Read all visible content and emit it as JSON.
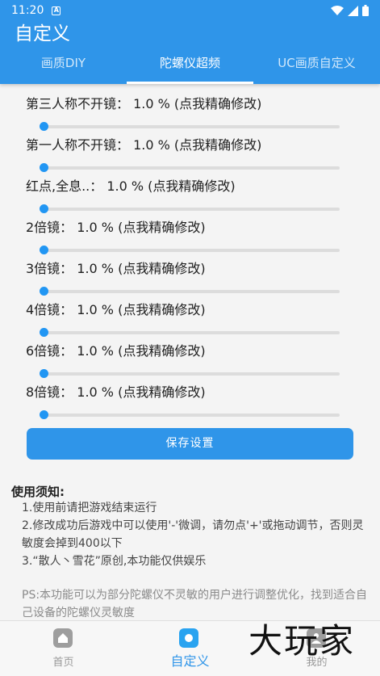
{
  "status_bar": {
    "time": "11:20",
    "notification_icon": "a-icon"
  },
  "app_bar": {
    "title": "自定义"
  },
  "tabs": [
    {
      "label": "画质DIY",
      "active": false
    },
    {
      "label": "陀螺仪超频",
      "active": true
    },
    {
      "label": "UC画质自定义",
      "active": false
    }
  ],
  "sliders": [
    {
      "label": "第三人称不开镜：  1.0 %  (点我精确修改)",
      "value_percent": 1.0
    },
    {
      "label": "第一人称不开镜：  1.0 %  (点我精确修改)",
      "value_percent": 1.0
    },
    {
      "label": "红点,全息..：  1.0 %  (点我精确修改)",
      "value_percent": 1.0
    },
    {
      "label": "2倍镜：  1.0 %  (点我精确修改)",
      "value_percent": 1.0
    },
    {
      "label": "3倍镜：  1.0 %  (点我精确修改)",
      "value_percent": 1.0
    },
    {
      "label": "4倍镜：  1.0 %  (点我精确修改)",
      "value_percent": 1.0
    },
    {
      "label": "6倍镜：  1.0 %  (点我精确修改)",
      "value_percent": 1.0
    },
    {
      "label": "8倍镜：  1.0 %  (点我精确修改)",
      "value_percent": 1.0
    }
  ],
  "save_button": "保存设置",
  "notes": {
    "title": "使用须知:",
    "items": [
      "1.使用前请把游戏结束运行",
      "2.修改成功后游戏中可以使用'-'微调，请勿点'+'或拖动调节，否则灵敏度会掉到400以下",
      "3.“散人丶雪花”原创,本功能仅供娱乐"
    ],
    "ps": "PS:本功能可以为部分陀螺仪不灵敏的用户进行调整优化，找到适合自己设备的陀螺仪灵敏度"
  },
  "bottom_nav": [
    {
      "label": "首页",
      "icon": "home-icon",
      "active": false
    },
    {
      "label": "自定义",
      "icon": "custom-icon",
      "active": true
    },
    {
      "label": "我的",
      "icon": "profile-icon",
      "active": false
    }
  ],
  "watermark": "大玩家",
  "colors": {
    "primary": "#2f95e9",
    "slider": "#2196f3"
  }
}
